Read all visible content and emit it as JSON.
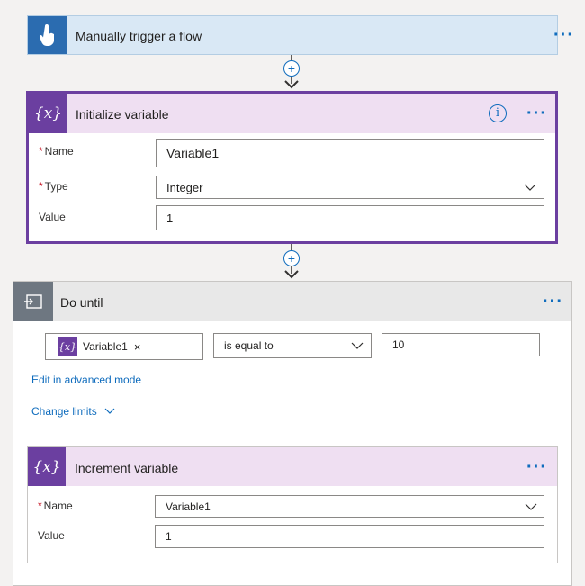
{
  "trigger": {
    "title": "Manually trigger a flow",
    "icon": "touch-hand-icon",
    "color": "#2b6cb0"
  },
  "connector1": {
    "plus": "+"
  },
  "init_variable": {
    "title": "Initialize variable",
    "icon_text": "{x}",
    "name_label": "Name",
    "name_value": "Variable1",
    "type_label": "Type",
    "type_value": "Integer",
    "value_label": "Value",
    "value_value": "1",
    "required_mark": "*",
    "info_glyph": "i",
    "accent": "#6b3fa0"
  },
  "connector2": {
    "plus": "+"
  },
  "do_until": {
    "title": "Do until",
    "token_icon": "{x}",
    "token_label": "Variable1",
    "token_remove": "×",
    "operator": "is equal to",
    "compare_value": "10",
    "advanced_link": "Edit in advanced mode",
    "limits_link": "Change limits"
  },
  "increment_variable": {
    "title": "Increment variable",
    "icon_text": "{x}",
    "name_label": "Name",
    "name_value": "Variable1",
    "value_label": "Value",
    "value_value": "1",
    "required_mark": "*"
  },
  "menu_dots": "···"
}
